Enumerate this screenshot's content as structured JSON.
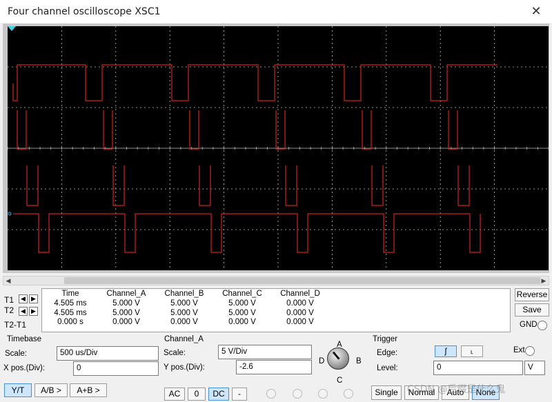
{
  "window": {
    "title": "Four channel oscilloscope XSC1",
    "close_glyph": "✕"
  },
  "colors": {
    "trace": "#d42020",
    "screen_bg": "#000000",
    "grid": "#bfbfbf",
    "trigger_marker": "#3fd2e6"
  },
  "channel_info": {
    "channel_a_label": "Channel_A",
    "channel_a_scale_v_per_div": 5,
    "channel_a_ypos_div": -2.6
  },
  "readout": {
    "row_labels": [
      "T1",
      "T2",
      "T2-T1"
    ],
    "columns": [
      {
        "header": "Time",
        "values": [
          "4.505 ms",
          "4.505 ms",
          "0.000 s"
        ]
      },
      {
        "header": "Channel_A",
        "values": [
          "5.000 V",
          "5.000 V",
          "0.000 V"
        ]
      },
      {
        "header": "Channel_B",
        "values": [
          "5.000 V",
          "5.000 V",
          "0.000 V"
        ]
      },
      {
        "header": "Channel_C",
        "values": [
          "5.000 V",
          "5.000 V",
          "0.000 V"
        ]
      },
      {
        "header": "Channel_D",
        "values": [
          "0.000 V",
          "0.000 V",
          "0.000 V"
        ]
      }
    ],
    "reverse_label": "Reverse",
    "save_label": "Save",
    "gnd_label": "GND"
  },
  "timebase": {
    "group_label": "Timebase",
    "scale_label": "Scale:",
    "scale_value": "500 us/Div",
    "xpos_label": "X pos.(Div):",
    "xpos_value": "0",
    "modes": [
      "Y/T",
      "A/B >",
      "A+B >"
    ],
    "active_mode": "Y/T"
  },
  "channel": {
    "group_label": "Channel_A",
    "scale_label": "Scale:",
    "scale_value": "5  V/Div",
    "ypos_label": "Y pos.(Div):",
    "ypos_value": "-2.6",
    "coupling": [
      "AC",
      "0",
      "DC",
      "-"
    ],
    "active_coupling": "DC",
    "knob_labels": {
      "a": "A",
      "b": "B",
      "c": "C",
      "d": "D"
    }
  },
  "trigger": {
    "group_label": "Trigger",
    "edge_label": "Edge:",
    "edge_rising": "ʃ",
    "edge_falling": "˪",
    "ext_label": "Ext",
    "level_label": "Level:",
    "level_value": "0",
    "level_unit": "V",
    "modes": [
      "Single",
      "Normal",
      "Auto",
      "None"
    ]
  },
  "watermark": "CSDN @后缀是什么鬼"
}
